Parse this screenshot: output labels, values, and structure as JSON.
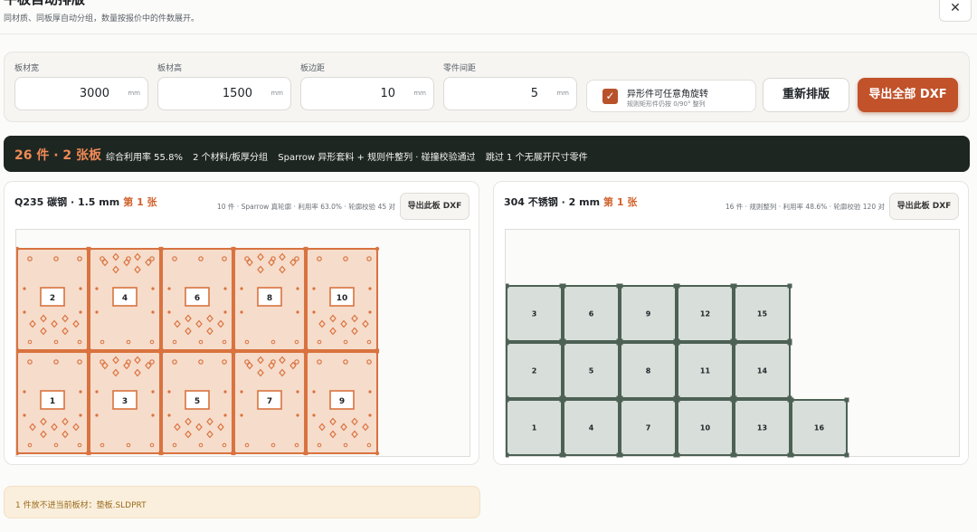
{
  "header": {
    "title": "平板自动排版",
    "subtitle": "同材质、同板厚自动分组，数量按报价中的件数展开。",
    "close_icon": "close-icon"
  },
  "config": {
    "fields": [
      {
        "label": "板材宽",
        "value": "3000",
        "unit": "mm"
      },
      {
        "label": "板材高",
        "value": "1500",
        "unit": "mm"
      },
      {
        "label": "板边距",
        "value": "10",
        "unit": "mm"
      },
      {
        "label": "零件间距",
        "value": "5",
        "unit": "mm"
      }
    ],
    "rotate": {
      "checked": true,
      "label": "异形件可任意角旋转",
      "sub": "规则矩形件仍按 0/90° 整列"
    },
    "relayout_label": "重新排版",
    "export_all_label": "导出全部 DXF"
  },
  "summary": {
    "main": "26 件 · 2 张板",
    "stats": [
      "综合利用率 55.8%",
      "2 个材料/板厚分组",
      "Sparrow 异形套料 + 规则件整列 · 碰撞校验通过",
      "跳过 1 个无展开尺寸零件"
    ]
  },
  "sheets": [
    {
      "material": "Q235 碳钢 · 1.5 mm",
      "sheet": "第 1 张",
      "meta": "10 件 · Sparrow 真轮廓 · 利用率 63.0% · 轮廓校验 45 对",
      "export_label": "导出此板 DXF",
      "accent": "#d9733f",
      "part_fill": "#f6dccb",
      "rows": [
        [
          "2",
          "4",
          "6",
          "8",
          "10"
        ],
        [
          "1",
          "3",
          "5",
          "7",
          "9"
        ]
      ]
    },
    {
      "material": "304 不锈钢 · 2 mm",
      "sheet": "第 1 张",
      "meta": "16 件 · 规则整列 · 利用率 48.6% · 轮廓校验 120 对",
      "export_label": "导出此板 DXF",
      "accent": "#4d6155",
      "part_fill": "#d8dfda",
      "rows": [
        [
          "3",
          "6",
          "9",
          "12",
          "15"
        ],
        [
          "2",
          "5",
          "8",
          "11",
          "14"
        ],
        [
          "1",
          "4",
          "7",
          "10",
          "13",
          "16"
        ]
      ]
    }
  ],
  "warning": {
    "text": "1 件放不进当前板材：垫板.SLDPRT"
  }
}
